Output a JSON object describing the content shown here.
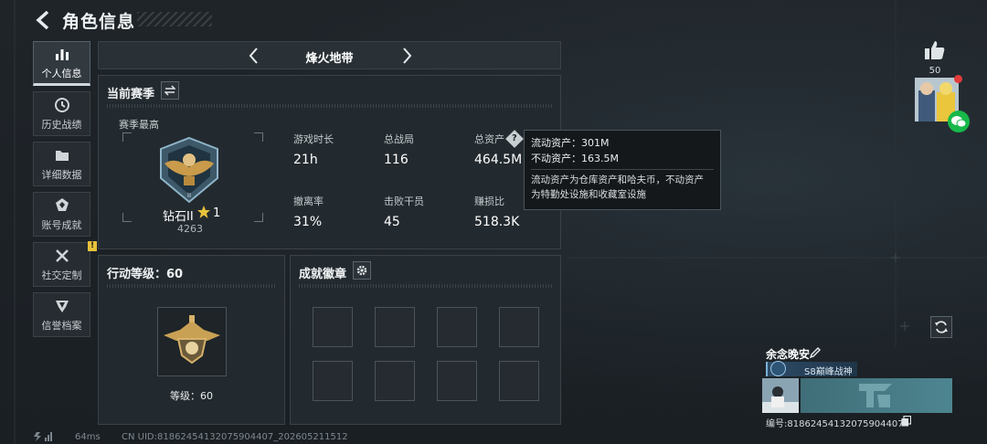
{
  "header": {
    "title": "角色信息"
  },
  "sidebar": {
    "items": [
      {
        "label": "个人信息",
        "icon": "bar-chart-icon",
        "active": true
      },
      {
        "label": "历史战绩",
        "icon": "history-clock-icon"
      },
      {
        "label": "详细数据",
        "icon": "folder-icon"
      },
      {
        "label": "账号成就",
        "icon": "achievement-icon"
      },
      {
        "label": "社交定制",
        "icon": "tools-icon",
        "badge": "!"
      },
      {
        "label": "信誉档案",
        "icon": "credit-shield-icon"
      }
    ]
  },
  "mode": {
    "name": "烽火地带"
  },
  "season": {
    "title": "当前赛季",
    "best_label": "赛季最高",
    "rank_name": "钻石II",
    "rank_stars": "1",
    "rank_score": "4263",
    "stats": [
      {
        "key": "游戏时长",
        "value": "21h"
      },
      {
        "key": "总战局",
        "value": "116"
      },
      {
        "key": "总资产",
        "value": "464.5M"
      },
      {
        "key": "撤离率",
        "value": "31%"
      },
      {
        "key": "击败干员",
        "value": "45"
      },
      {
        "key": "赚损比",
        "value": "518.3K"
      }
    ]
  },
  "tooltip": {
    "liquid": "流动资产：301M",
    "fixed": "不动资产：163.5M",
    "desc_line1": "流动资产为仓库资产和哈夫币，不动资产",
    "desc_line2": "为特勤处设施和收藏室设施"
  },
  "action_level": {
    "title": "行动等级：60",
    "level_label": "等级：60"
  },
  "achievements": {
    "title": "成就徽章"
  },
  "profile": {
    "likes": "50",
    "player_name": "余念晚安",
    "title_tag": "S8巅峰战神",
    "player_id": "编号:81862454132075904407"
  },
  "status": {
    "ping": "64ms",
    "uid": "CN UID:81862454132075904407_202605211512"
  },
  "colors": {
    "accent": "#e8c23a",
    "wechat": "#18b84a",
    "panel": "#232a2f"
  }
}
